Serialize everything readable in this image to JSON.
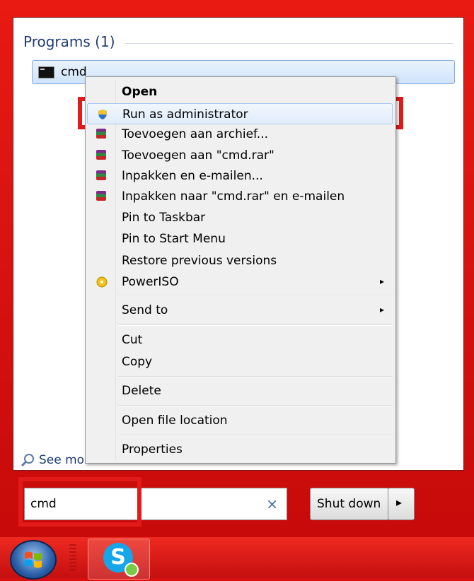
{
  "programs": {
    "section_title": "Programs (1)",
    "item_label": "cmd",
    "item_icon": "console-icon"
  },
  "context_menu": {
    "items": [
      {
        "label": "Open",
        "bold": true,
        "icon": ""
      },
      {
        "label": "Run as administrator",
        "icon": "uac-shield-icon",
        "highlighted": true
      },
      {
        "label": "Toevoegen aan archief...",
        "icon": "winrar-icon"
      },
      {
        "label": "Toevoegen aan \"cmd.rar\"",
        "icon": "winrar-icon"
      },
      {
        "label": "Inpakken en e-mailen...",
        "icon": "winrar-icon"
      },
      {
        "label": "Inpakken naar \"cmd.rar\" en e-mailen",
        "icon": "winrar-icon"
      },
      {
        "label": "Pin to Taskbar",
        "icon": ""
      },
      {
        "label": "Pin to Start Menu",
        "icon": ""
      },
      {
        "label": "Restore previous versions",
        "icon": ""
      },
      {
        "label": "PowerISO",
        "icon": "poweriso-icon",
        "submenu": true
      },
      {
        "label": "Send to",
        "submenu": true
      },
      {
        "label": "Cut"
      },
      {
        "label": "Copy"
      },
      {
        "label": "Delete"
      },
      {
        "label": "Open file location"
      },
      {
        "label": "Properties"
      }
    ],
    "submenu_arrow": "▸"
  },
  "see_more": {
    "label": "See more results"
  },
  "search": {
    "value": "cmd",
    "clear_glyph": "×"
  },
  "shutdown": {
    "label": "Shut down",
    "arrow": "▸"
  },
  "colors": {
    "highlight_box": "#e11a1a",
    "taskbar": "#d80f0f",
    "accent_text": "#1e3c78"
  }
}
